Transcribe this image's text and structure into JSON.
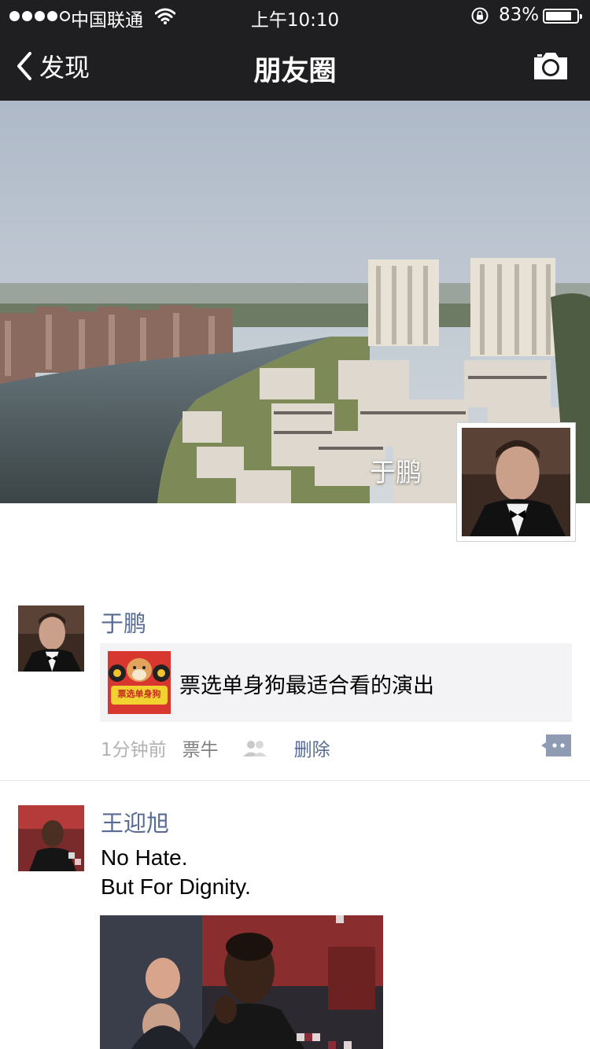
{
  "status_bar": {
    "carrier": "中国联通",
    "time": "上午10:10",
    "battery_text": "83%",
    "battery_level": 0.83,
    "signal_bars_filled": 4,
    "signal_bars_total": 5
  },
  "nav": {
    "back_label": "发现",
    "title": "朋友圈"
  },
  "cover": {
    "user_name": "于鹏"
  },
  "posts": [
    {
      "author": "于鹏",
      "share": {
        "thumb_text": "票选单身狗",
        "text": "票选单身狗最适合看的演出"
      },
      "time": "1分钟前",
      "source": "票牛",
      "delete_label": "删除"
    },
    {
      "author": "王迎旭",
      "text_line_1": "No Hate.",
      "text_line_2": "But For Dignity."
    }
  ],
  "colors": {
    "nav_bg": "#1f1f21",
    "link_blue": "#576b95",
    "meta_gray": "#b2b2b2",
    "share_bg": "#f3f3f5"
  }
}
